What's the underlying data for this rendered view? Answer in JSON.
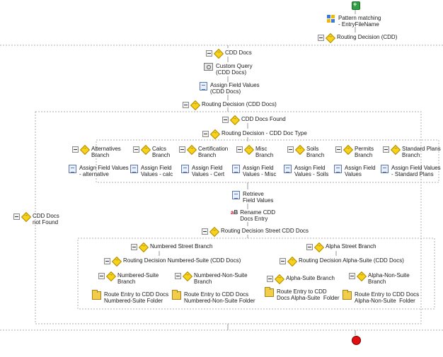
{
  "nodes": {
    "pattern": "Pattern matching\n- EntryFileName",
    "routing_cdd": "Routing Decision (CDD)",
    "cdd_docs": "CDD Docs",
    "custom_query": "Custom Query\n(CDD Docs)",
    "assign_cdd_docs": "Assign Field Values\n(CDD Docs)",
    "routing_cdd_docs": "Routing Decision (CDD Docs)",
    "cdd_docs_found": "CDD Docs Found",
    "routing_doc_type": "Routing Decision - CDD Doc Type",
    "alternatives_branch": "Alternatives\nBranch",
    "calcs_branch": "Calcs\nBranch",
    "certification_branch": "Certification\nBranch",
    "misc_branch": "Misc\nBranch",
    "soils_branch": "Soils\nBranch",
    "permits_branch": "Permits\nBranch",
    "standard_plans_branch": "Standard Plans\nBranch",
    "assign_alternative": "Assign Field Values\n- alternative",
    "assign_calc": "Assign Field\nValues - calc",
    "assign_cert": "Assign Field\nValues - Cert",
    "assign_misc": "Assign Field\nValues - Misc",
    "assign_soils": "Assign Field\nValues - Soils",
    "assign_values": "Assign Field\nValues",
    "assign_standard_plans": "Assign Field Values\n- Standard Plans",
    "retrieve": "Retrieve\nField Values",
    "rename": "Rename CDD\nDocs Entry",
    "routing_street": "Routing Decision Street CDD Docs",
    "numbered_street": "Numbered Street Branch",
    "alpha_street": "Alpha Street Branch",
    "routing_numbered_suite": "Routing Decision Numbered-Suite (CDD Docs)",
    "routing_alpha_suite": "Routing Decision Alpha-Suite (CDD Docs)",
    "numbered_suite_branch": "Numbered-Suite\nBranch",
    "numbered_non_suite_branch": "Numbered-Non-Suite\nBranch",
    "alpha_suite_branch": "Alpha-Suite Branch",
    "alpha_non_suite_branch": "Alpha-Non-Suite\nBranch",
    "route_numbered_suite": "Route Entry to CDD Docs\nNumbered-Suite Folder",
    "route_numbered_non_suite": "Route Entry to CDD Docs\nNumbered-Non-Suite Folder",
    "route_alpha_suite": "Route Entry to CDD\nDocs Alpha-Suite  Folder",
    "route_alpha_non_suite": "Route Entry to CDD Docs\nAlpha-Non-Suite  Folder",
    "not_found": "CDD Docs\nnot Found"
  },
  "icons": {
    "start": "start-icon",
    "end": "end-icon",
    "collapse": "collapse-icon",
    "decision": "decision-diamond-icon",
    "document": "assign-document-icon",
    "query": "custom-query-icon",
    "folder": "route-folder-icon",
    "rename": "rename-icon",
    "retrieve": "retrieve-icon",
    "pattern": "pattern-matching-icon"
  },
  "colors": {
    "start": "#2ea043",
    "end": "#e01010",
    "decision": "#f6d21a",
    "connector": "#9a9a9a",
    "dashed": "#b0b0b0"
  }
}
